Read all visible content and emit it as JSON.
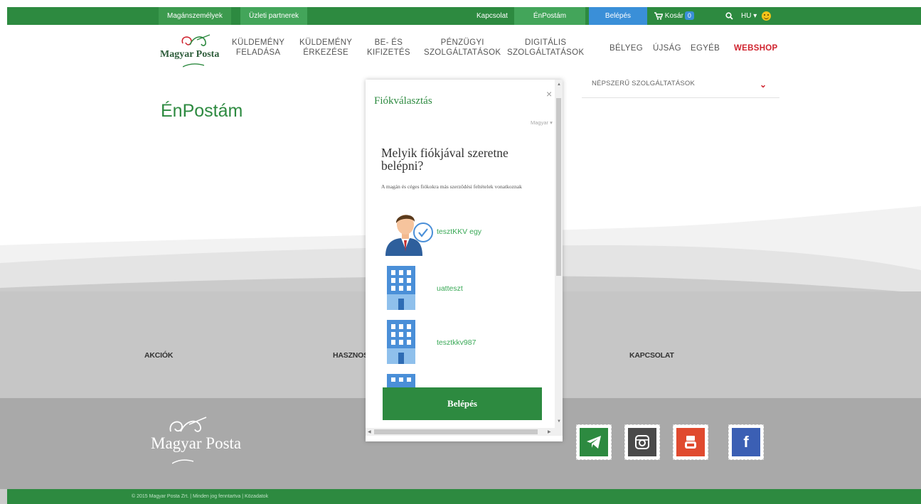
{
  "topbar": {
    "private": "Magánszemélyek",
    "business": "Üzleti partnerek",
    "contact": "Kapcsolat",
    "enpostam": "ÉnPostám",
    "login": "Belépés",
    "cart": "Kosár",
    "cart_count": "0",
    "lang": "HU"
  },
  "logo": {
    "text": "Magyar Posta"
  },
  "nav": [
    "KÜLDEMÉNY\nFELADÁSA",
    "KÜLDEMÉNY\nÉRKEZÉSE",
    "BE- ÉS\nKIFIZETÉS",
    "PÉNZÜGYI\nSZOLGÁLTATÁSOK",
    "DIGITÁLIS\nSZOLGÁLTATÁSOK",
    "BÉLYEG",
    "ÚJSÁG",
    "EGYÉB",
    "WEBSHOP"
  ],
  "popular": {
    "label": "NÉPSZERŰ SZOLGÁLTATÁSOK"
  },
  "page_title": "ÉnPostám",
  "footer": {
    "links": [
      "AKCIÓK",
      "HASZNOS",
      "KAPCSOLAT"
    ],
    "logo_text": "Magyar Posta",
    "bottom": "© 2015 Magyar Posta Zrt.  |  Minden jog fenntartva  |  Közadatok"
  },
  "modal": {
    "title": "Fiókválasztás",
    "close": "×",
    "language": "Magyar",
    "question": "Melyik fiókjával szeretne belépni?",
    "note": "A magán és céges fiókokra más szerződési feltételek vonatkoznak",
    "accounts": [
      {
        "name": "tesztKKV egy",
        "type": "person",
        "selected": true
      },
      {
        "name": "uatteszt",
        "type": "company",
        "selected": false
      },
      {
        "name": "tesztkkv987",
        "type": "company",
        "selected": false
      }
    ],
    "login_button": "Belépés"
  },
  "colors": {
    "brand_green": "#2d8a40",
    "webshop_red": "#d0242f",
    "link_green": "#3aa957",
    "account_blue": "#4a8fd8"
  },
  "social_icons": [
    "telegram-icon",
    "instagram-icon",
    "youtube-icon",
    "facebook-icon"
  ]
}
